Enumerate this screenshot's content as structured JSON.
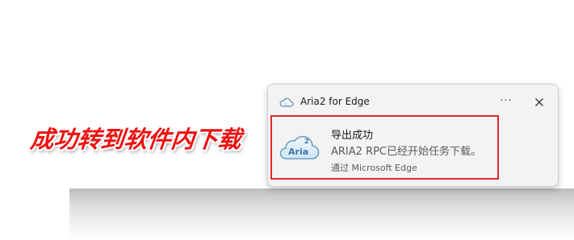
{
  "annotation": {
    "caption": "成功转到软件内下载",
    "color": "#ee1111"
  },
  "toast": {
    "app_name": "Aria2 for Edge",
    "more_label": "···",
    "heading": "导出成功",
    "body": "ARIA2 RPC已经开始任务下载。",
    "source": "通过 Microsoft Edge",
    "icon": {
      "name": "aria2-cloud-icon",
      "badge_text": "2",
      "logo_text": "Aria"
    },
    "highlight_color": "#e3262f"
  }
}
